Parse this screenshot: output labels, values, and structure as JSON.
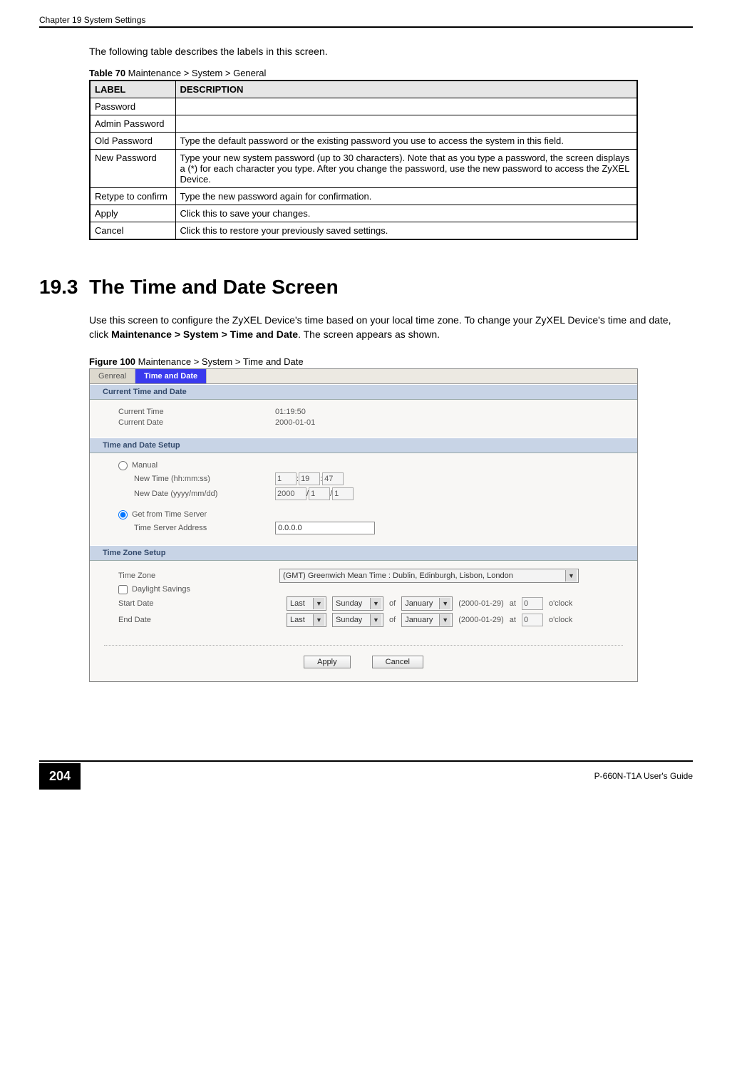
{
  "header": {
    "chapter": "Chapter 19 System Settings"
  },
  "intro": "The following table describes the labels in this screen.",
  "table": {
    "caption_bold": "Table 70",
    "caption_rest": "   Maintenance > System > General",
    "headers": {
      "label": "LABEL",
      "desc": "DESCRIPTION"
    },
    "rows": [
      {
        "label": "Password",
        "desc": ""
      },
      {
        "label": "Admin Password",
        "desc": ""
      },
      {
        "label": "Old Password",
        "indent": true,
        "desc": "Type the default password or the existing password you use to access the system in this field."
      },
      {
        "label": "New Password",
        "indent": true,
        "desc": "Type your new system password (up to 30 characters). Note that as you type a password, the screen displays a (*) for each character you type. After you change the password, use the new password to access the ZyXEL Device."
      },
      {
        "label": "Retype to confirm",
        "indent": true,
        "desc": "Type the new password again for confirmation."
      },
      {
        "label": "Apply",
        "desc": "Click this to save your changes."
      },
      {
        "label": "Cancel",
        "desc": "Click this to restore your previously saved settings."
      }
    ]
  },
  "section": {
    "number": "19.3",
    "title": "The Time and Date Screen",
    "para_pre": "Use this screen to configure the ZyXEL Device's time based on your local time zone. To change your ZyXEL Device's time and date, click ",
    "para_bold": "Maintenance > System > Time and Date",
    "para_post": ". The screen appears as shown."
  },
  "figure": {
    "caption_bold": "Figure 100",
    "caption_rest": "   Maintenance > System > Time and Date"
  },
  "screenshot": {
    "tabs": {
      "inactive": "Genreal",
      "active": "Time and Date"
    },
    "panels": {
      "currentHeading": "Current Time and Date",
      "current": {
        "timeLabel": "Current Time",
        "timeValue": "01:19:50",
        "dateLabel": "Current Date",
        "dateValue": "2000-01-01"
      },
      "setupHeading": "Time and Date Setup",
      "setup": {
        "manual": "Manual",
        "newTimeLabel": "New Time (hh:mm:ss)",
        "hh": "1",
        "mm": "19",
        "ss": "47",
        "newDateLabel": "New Date (yyyy/mm/dd)",
        "yyyy": "2000",
        "mon": "1",
        "dd": "1",
        "fromServer": "Get from Time Server",
        "serverLabel": "Time Server Address",
        "serverValue": "0.0.0.0"
      },
      "tzHeading": "Time Zone Setup",
      "tz": {
        "tzLabel": "Time Zone",
        "tzValue": "(GMT) Greenwich Mean Time : Dublin, Edinburgh, Lisbon, London",
        "dsLabel": "Daylight Savings",
        "startLabel": "Start Date",
        "endLabel": "End Date",
        "week": "Last",
        "day": "Sunday",
        "of": "of",
        "month": "January",
        "dateParen": "(2000-01-29)",
        "at": "at",
        "hour": "0",
        "oclock": "o'clock"
      }
    },
    "buttons": {
      "apply": "Apply",
      "cancel": "Cancel"
    }
  },
  "footer": {
    "page": "204",
    "guide": "P-660N-T1A User's Guide"
  }
}
